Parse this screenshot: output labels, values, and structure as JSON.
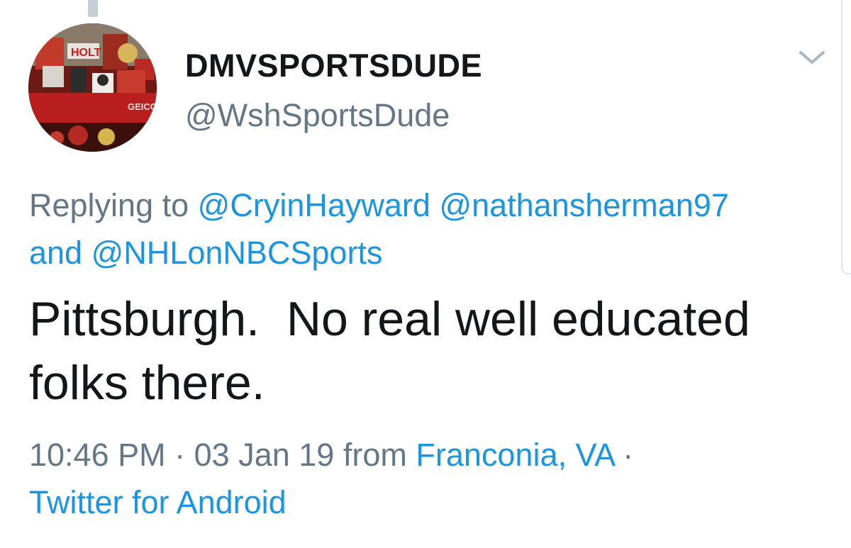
{
  "tweet": {
    "display_name": "DMVSPORTSDUDE",
    "handle": "@WshSportsDude",
    "reply_prefix": "Replying to",
    "reply_mentions": [
      "@CryinHayward",
      "@nathansherman97"
    ],
    "reply_conjunction": "and",
    "reply_last_mention": "@NHLonNBCSports",
    "text": "Pittsburgh.  No real well educated folks there.",
    "time": "10:46 PM",
    "separator": "·",
    "date": "03 Jan 19",
    "from_label": "from",
    "location": "Franconia, VA",
    "source": "Twitter for Android"
  },
  "icons": {
    "menu": "chevron-down-icon",
    "avatar": "profile-photo"
  },
  "colors": {
    "text_primary": "#14171a",
    "text_secondary": "#657786",
    "link_blue": "#1b95e0",
    "thread_line": "#c4cfd6"
  }
}
